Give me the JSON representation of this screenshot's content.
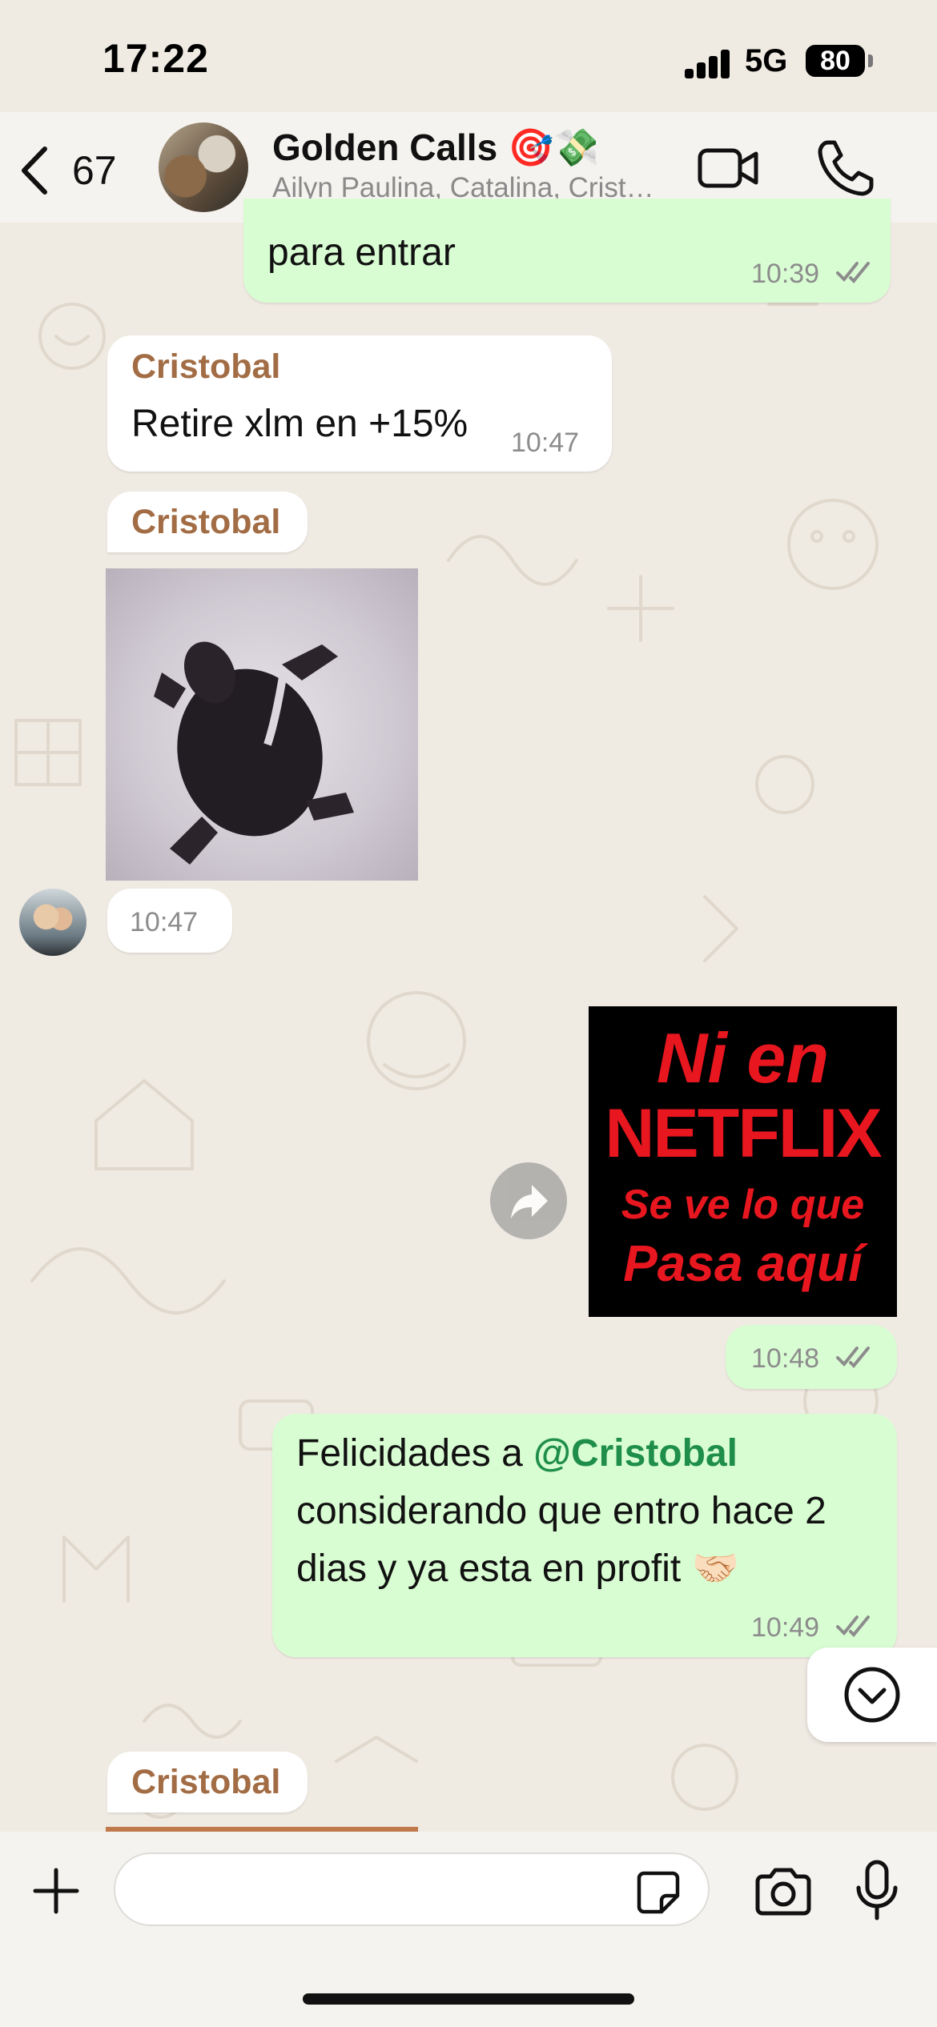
{
  "status_bar": {
    "time": "17:22",
    "network": "5G",
    "battery": "80"
  },
  "header": {
    "back_count": "67",
    "title": "Golden Calls 🎯💸",
    "subtitle": "Ailyn Paulina, Catalina, Crist…"
  },
  "messages": {
    "m1": {
      "text": "para entrar",
      "time": "10:39"
    },
    "m2": {
      "sender": "Cristobal",
      "text": "Retire xlm en +15%",
      "time": "10:47"
    },
    "m3": {
      "sender": "Cristobal",
      "time": "10:47"
    },
    "m4": {
      "image_text": [
        "Ni en",
        "NETFLIX",
        "Se ve lo que",
        "Pasa aquí"
      ],
      "time": "10:48"
    },
    "m5": {
      "text_before": "Felicidades a ",
      "mention": "@Cristobal",
      "line2": "considerando que entro hace 2",
      "line3": "dias y ya esta en profit 🤝🏻",
      "time": "10:49"
    },
    "m6": {
      "sender": "Cristobal"
    }
  },
  "composer": {
    "placeholder": ""
  },
  "colors": {
    "outgoing": "#d9fdd3",
    "incoming": "#ffffff",
    "sender": "#a26d45",
    "mention": "#1f8e4b",
    "read_ticks": "#8c8c8c"
  }
}
